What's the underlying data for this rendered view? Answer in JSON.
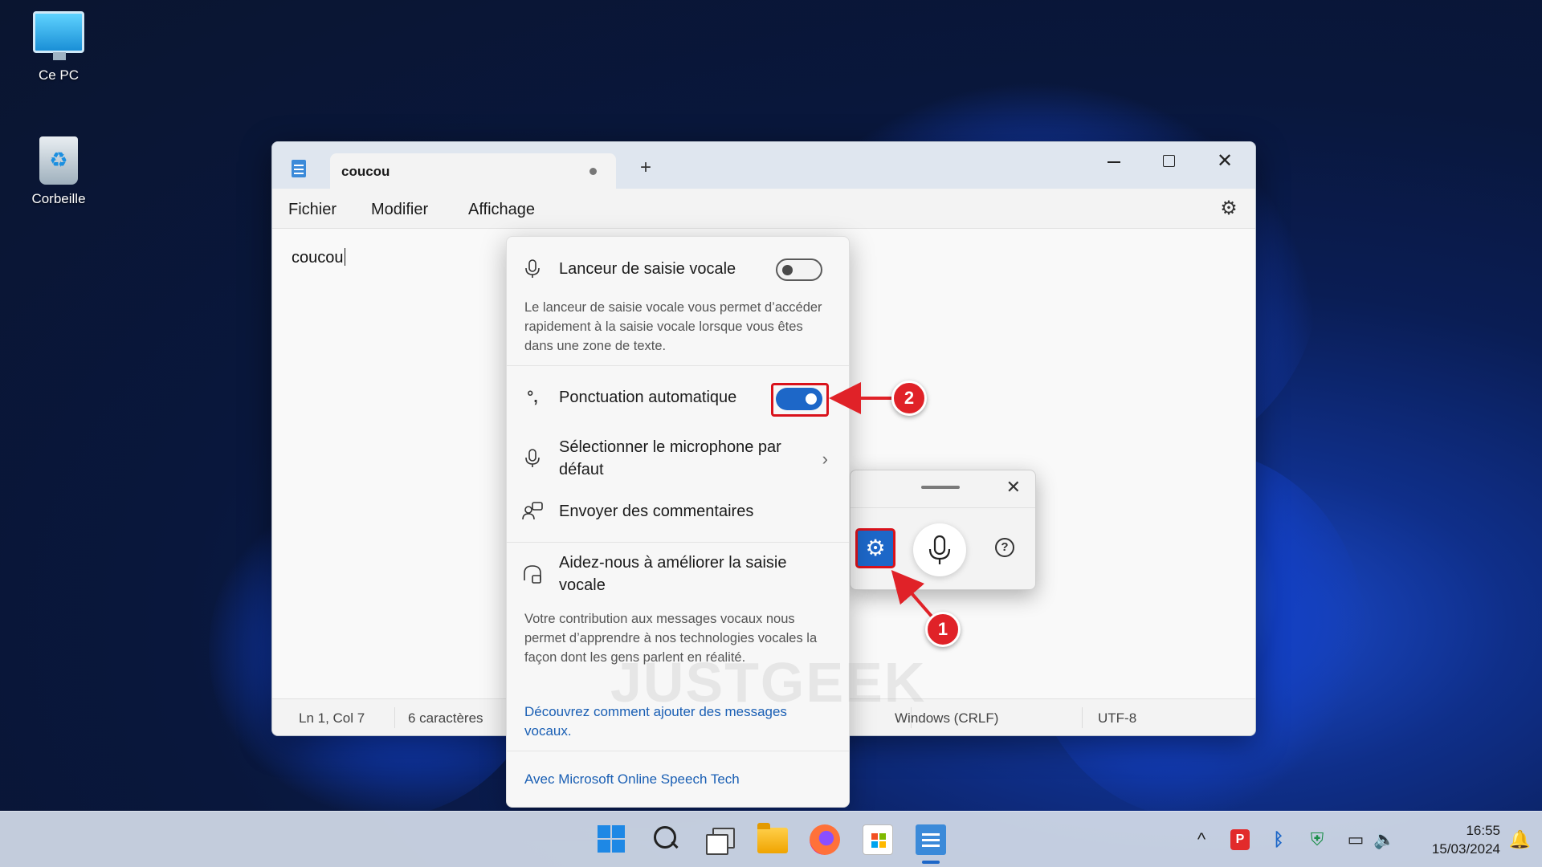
{
  "desktop": {
    "icons": [
      {
        "label": "Ce PC",
        "icon": "computer-icon"
      },
      {
        "label": "Corbeille",
        "icon": "recycle-bin-icon"
      }
    ]
  },
  "window": {
    "tab_title": "coucou",
    "new_tab_symbol": "+",
    "close_symbol": "✕",
    "menu": [
      "Fichier",
      "Modifier",
      "Affichage"
    ],
    "settings_icon": "gear-icon",
    "editor_text": "coucou",
    "status": {
      "position": "Ln 1, Col 7",
      "chars": "6 caractères",
      "line_ending": "Windows (CRLF)",
      "encoding": "UTF-8"
    }
  },
  "voice_settings": {
    "launcher": {
      "title": "Lanceur de saisie vocale",
      "enabled": false,
      "description": "Le lanceur de saisie vocale vous permet d’accéder rapidement à la saisie vocale lorsque vous êtes dans une zone de texte."
    },
    "auto_punctuation": {
      "title": "Ponctuation automatique",
      "enabled": true
    },
    "microphone": {
      "title": "Sélectionner le microphone par défaut",
      "chevron": "›"
    },
    "feedback": {
      "title": "Envoyer des commentaires"
    },
    "improve": {
      "title": "Aidez-nous à améliorer la saisie vocale",
      "description": "Votre contribution aux messages vocaux nous permet d’apprendre à nos technologies vocales la façon dont les gens parlent en réalité.",
      "link": "Découvrez comment ajouter des messages vocaux."
    },
    "footer_link": "Avec Microsoft Online Speech Tech"
  },
  "voice_panel": {
    "close_symbol": "✕",
    "help_symbol": "?",
    "gear_symbol": "⚙"
  },
  "annotations": {
    "badge1": "1",
    "badge2": "2",
    "accent": "#e02228"
  },
  "watermark": "JUSTGEEK",
  "taskbar": {
    "apps": [
      "windows-start-icon",
      "search-icon",
      "task-view-icon",
      "file-explorer-icon",
      "firefox-icon",
      "microsoft-store-icon",
      "notepad-icon"
    ],
    "tray_chevron": "^",
    "time": "16:55",
    "date": "15/03/2024"
  },
  "colors": {
    "accent_blue": "#1d67c8",
    "highlight_red": "#d9121b",
    "link_blue": "#1a5fb4"
  }
}
